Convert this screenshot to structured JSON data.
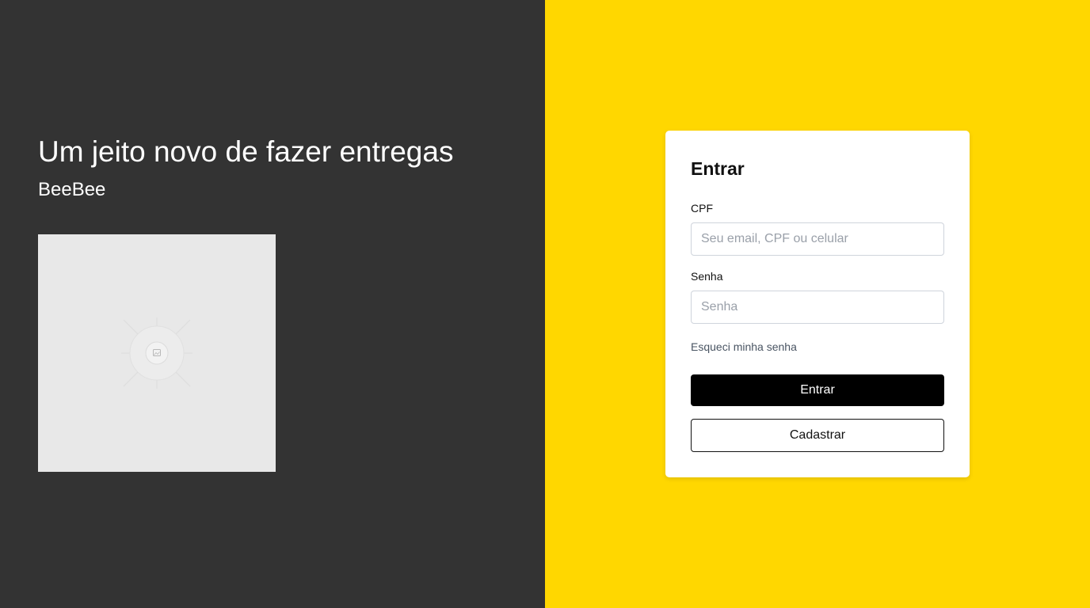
{
  "hero": {
    "headline": "Um jeito novo de fazer entregas",
    "brand": "BeeBee",
    "image_icon": "image-placeholder-icon"
  },
  "login": {
    "title": "Entrar",
    "cpf_label": "CPF",
    "cpf_placeholder": "Seu email, CPF ou celular",
    "cpf_value": "",
    "password_label": "Senha",
    "password_placeholder": "Senha",
    "password_value": "",
    "forgot_link": "Esqueci minha senha",
    "submit_label": "Entrar",
    "register_label": "Cadastrar"
  },
  "colors": {
    "left_background": "#333333",
    "right_background": "#FFD700",
    "card_background": "#FFFFFF",
    "primary_button": "#000000",
    "image_placeholder": "#E8E8E8"
  }
}
